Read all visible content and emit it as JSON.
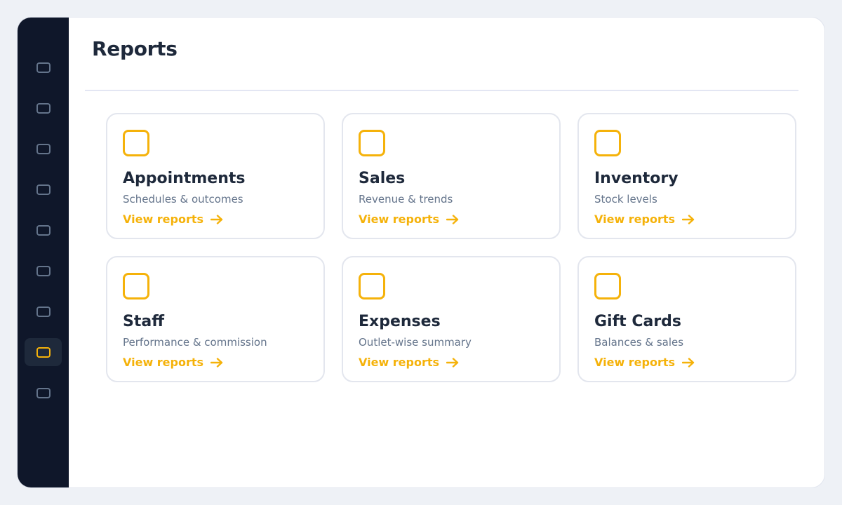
{
  "page": {
    "title": "Reports"
  },
  "colors": {
    "accent": "#f5b20a",
    "sidebar": "#0f172a",
    "text": "#1e293b",
    "muted": "#64748b"
  },
  "sidebar": {
    "active_index": 7,
    "items": [
      {
        "icon": "nav-icon"
      },
      {
        "icon": "nav-icon"
      },
      {
        "icon": "nav-icon"
      },
      {
        "icon": "nav-icon"
      },
      {
        "icon": "nav-icon"
      },
      {
        "icon": "nav-icon"
      },
      {
        "icon": "nav-icon"
      },
      {
        "icon": "reports-icon"
      },
      {
        "icon": "nav-icon"
      }
    ]
  },
  "cards": [
    {
      "title": "Appointments",
      "subtitle": "Schedules & outcomes",
      "link": "View reports"
    },
    {
      "title": "Sales",
      "subtitle": "Revenue & trends",
      "link": "View reports"
    },
    {
      "title": "Inventory",
      "subtitle": "Stock levels",
      "link": "View reports"
    },
    {
      "title": "Staff",
      "subtitle": "Performance & commission",
      "link": "View reports"
    },
    {
      "title": "Expenses",
      "subtitle": "Outlet-wise summary",
      "link": "View reports"
    },
    {
      "title": "Gift Cards",
      "subtitle": "Balances & sales",
      "link": "View reports"
    }
  ]
}
